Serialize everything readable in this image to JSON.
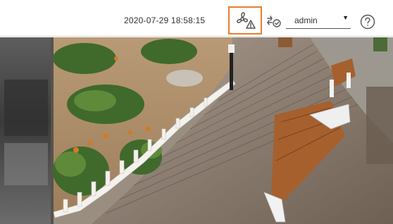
{
  "header": {
    "datetime": "2020-07-29 18:58:15",
    "user": {
      "selected": "admin",
      "options": [
        "admin"
      ]
    }
  },
  "icons": {
    "fan_alert": "fan-alert-icon",
    "sync_status": "sync-check-icon",
    "help": "help-icon",
    "dropdown": "caret-down-icon"
  },
  "colors": {
    "alert_highlight": "#ec7b2d",
    "header_background": "#ffffff",
    "icon_stroke": "#555555"
  }
}
